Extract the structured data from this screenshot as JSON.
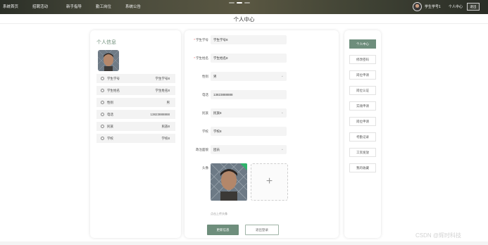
{
  "nav": {
    "items": [
      "系统首页",
      "招聘活动",
      "新手指导",
      "勤工岗位",
      "系统公告"
    ],
    "user_name": "学生学号1",
    "user_center": "个人中心",
    "logout": "退出"
  },
  "page_title": "个人中心",
  "info_panel": {
    "title": "个人信息",
    "rows": [
      {
        "label": "学生学号",
        "value": "学生学号8"
      },
      {
        "label": "学生姓名",
        "value": "学生姓名8"
      },
      {
        "label": "性别",
        "value": "男"
      },
      {
        "label": "电话",
        "value": "13823888888"
      },
      {
        "label": "民族",
        "value": "民族8"
      },
      {
        "label": "学校",
        "value": "学校8"
      }
    ]
  },
  "form": {
    "fields": [
      {
        "label": "学生学号",
        "required": "*",
        "value": "学生学号8"
      },
      {
        "label": "学生姓名",
        "required": "*",
        "value": "学生姓名8"
      },
      {
        "label": "性别",
        "required": "",
        "value": "男",
        "select": true
      },
      {
        "label": "电话",
        "required": "",
        "value": "13823888888"
      },
      {
        "label": "民族",
        "required": "",
        "value": "民族8",
        "select": true
      },
      {
        "label": "学校",
        "required": "",
        "value": "学校8"
      },
      {
        "label": "政治面貌",
        "required": "",
        "value": "团员",
        "select": true
      }
    ],
    "avatar_label": "头像",
    "upload_hint": "点击上传头像",
    "save_label": "更新信息",
    "exit_label": "退出登录",
    "upload_plus": "+"
  },
  "menu": {
    "items": [
      "个人中心",
      "修改密码",
      "岗位申请",
      "岗位认证",
      "实践申请",
      "岗位申请",
      "考勤记录",
      "工资发放",
      "我的收藏"
    ],
    "active_index": 0
  },
  "watermark": "CSDN @辉时科技",
  "colors": {
    "accent": "#6e8e7c",
    "required": "#e55555"
  }
}
